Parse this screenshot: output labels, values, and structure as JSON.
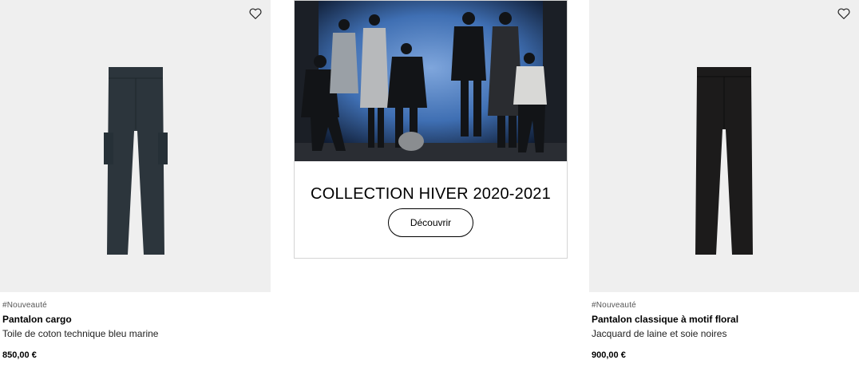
{
  "products": [
    {
      "tag": "#Nouveauté",
      "name": "Pantalon cargo",
      "description": "Toile de coton technique bleu marine",
      "price": "850,00 €"
    },
    {
      "tag": "#Nouveauté",
      "name": "Pantalon classique à motif floral",
      "description": "Jacquard de laine et soie noires",
      "price": "900,00 €"
    }
  ],
  "promo": {
    "title": "COLLECTION HIVER 2020-2021",
    "button_label": "Découvrir"
  },
  "icons": {
    "favorite": "heart-outline-icon"
  },
  "colors": {
    "product_background": "#efefef",
    "cargo_fabric": "#2c353c",
    "classic_fabric": "#1c1b1b",
    "promo_backdrop": "#3f6fb3"
  }
}
